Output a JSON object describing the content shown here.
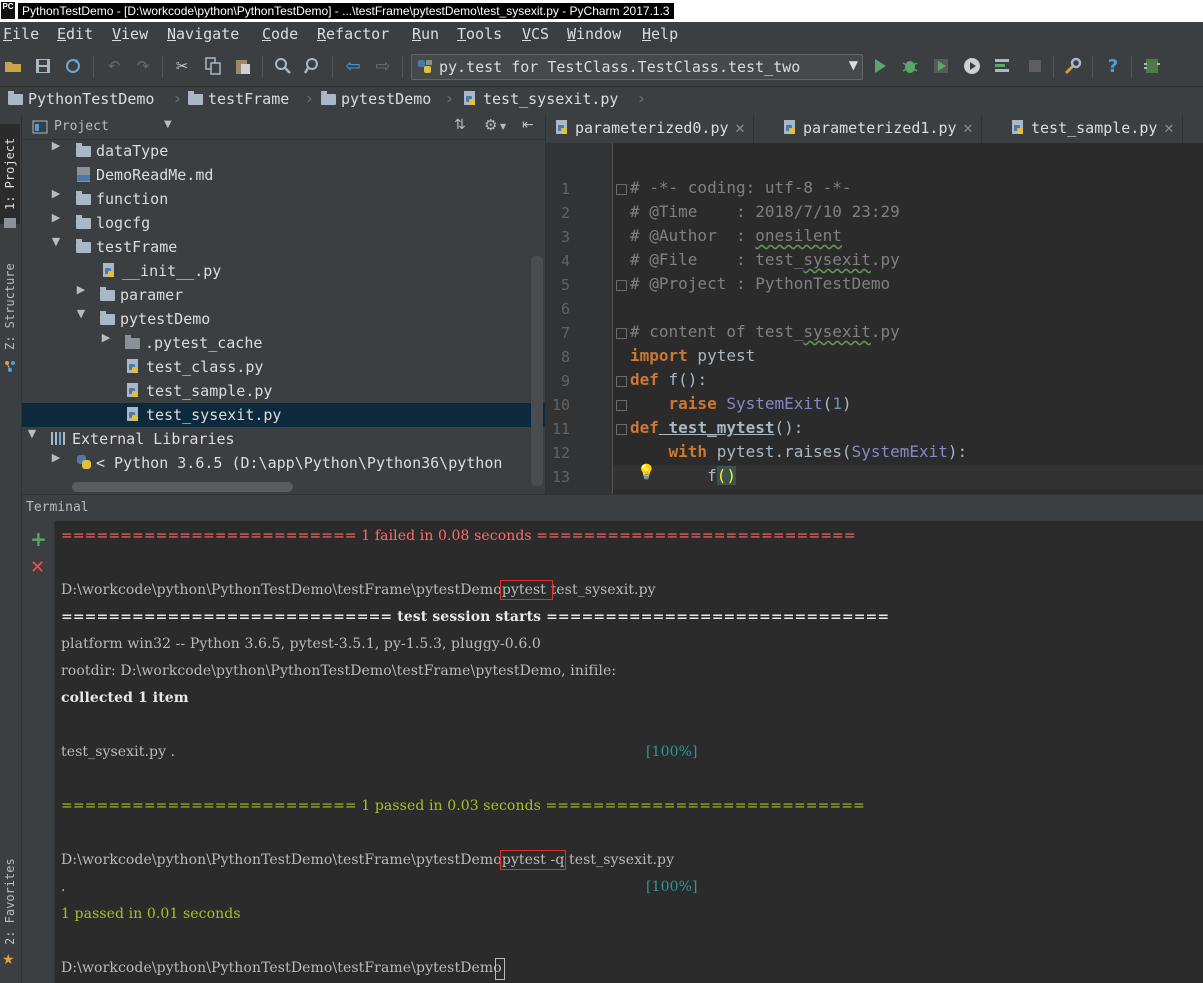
{
  "window": {
    "title": "PythonTestDemo - [D:\\workcode\\python\\PythonTestDemo] - ...\\testFrame\\pytestDemo\\test_sysexit.py - PyCharm 2017.1.3",
    "app_icon_text": "PC"
  },
  "menu": [
    "File",
    "Edit",
    "View",
    "Navigate",
    "Code",
    "Refactor",
    "Run",
    "Tools",
    "VCS",
    "Window",
    "Help"
  ],
  "toolbar": {
    "run_config": "py.test for TestClass.TestClass.test_two",
    "help_label": "?"
  },
  "breadcrumb": [
    "PythonTestDemo",
    "testFrame",
    "pytestDemo",
    "test_sysexit.py"
  ],
  "left_strip": {
    "project_tab": "1: Project",
    "structure_tab": "Z: Structure",
    "favorites_tab": "2: Favorites"
  },
  "project_panel": {
    "title": "Project",
    "tree": [
      {
        "label": "dataType",
        "kind": "folder",
        "expanded": false
      },
      {
        "label": "DemoReadMe.md",
        "kind": "md"
      },
      {
        "label": "function",
        "kind": "folder",
        "expanded": false
      },
      {
        "label": "logcfg",
        "kind": "folder",
        "expanded": false
      },
      {
        "label": "testFrame",
        "kind": "folder",
        "expanded": true
      },
      {
        "label": "__init__.py",
        "kind": "py"
      },
      {
        "label": "paramer",
        "kind": "folder",
        "expanded": false
      },
      {
        "label": "pytestDemo",
        "kind": "folder",
        "expanded": true
      },
      {
        "label": ".pytest_cache",
        "kind": "folder",
        "expanded": false
      },
      {
        "label": "test_class.py",
        "kind": "py"
      },
      {
        "label": "test_sample.py",
        "kind": "py"
      },
      {
        "label": "test_sysexit.py",
        "kind": "py",
        "selected": true
      },
      {
        "label": "External Libraries",
        "kind": "lib",
        "expanded": true
      },
      {
        "label": "< Python 3.6.5 (D:\\app\\Python\\Python36\\python",
        "kind": "pylib",
        "expanded": false
      }
    ]
  },
  "editor_tabs": [
    "parameterized0.py",
    "parameterized1.py",
    "test_sample.py"
  ],
  "editor": {
    "line_numbers": [
      "1",
      "2",
      "3",
      "4",
      "5",
      "6",
      "7",
      "8",
      "9",
      "10",
      "11",
      "12",
      "13"
    ],
    "comment1": "# -*- coding: utf-8 -*-",
    "time_label": "# @Time    : ",
    "time_value": "2018/7/10 23:29",
    "author_label": "# @Author  : ",
    "author_value": "onesilent",
    "file_label": "# @File    : test_",
    "file_sq": "sysexit",
    "file_ext": ".py",
    "project_line": "# @Project : PythonTestDemo",
    "content_pre": "# content of test_",
    "content_sq": "sysexit",
    "content_ext": ".py",
    "kw_import": "import",
    "import_mod": " pytest",
    "kw_def": "def",
    "f_name": " f",
    "f_rest": "():",
    "kw_raise": "raise",
    "sysexit": "SystemExit",
    "paren_open": "(",
    "num_one": "1",
    "paren_close": ")",
    "test_fn": " test_mytest",
    "kw_with": "with",
    "with_mid": " pytest.raises(",
    "with_end": "):",
    "call_f": "f",
    "call_parens": "()"
  },
  "terminal": {
    "title": "Terminal",
    "failed_line": "========================= 1 failed in 0.08 seconds ===========================",
    "prompt1": "D:\\workcode\\python\\PythonTestDemo\\testFrame\\pytestDemo",
    "cmd1": "pytest ",
    "cmd1_rest": "test_sysexit.py",
    "session_line": "============================ test session starts =============================",
    "platform_line": "platform win32 -- Python 3.6.5, pytest-3.5.1, py-1.5.3, pluggy-0.6.0",
    "rootdir_line": "rootdir: D:\\workcode\\python\\PythonTestDemo\\testFrame\\pytestDemo, inifile:",
    "collected_line": "collected 1 item",
    "result_file": "test_sysexit.py .",
    "progress1": "[100%]",
    "passed_line": "========================= 1 passed in 0.03 seconds ===========================",
    "prompt2": "D:\\workcode\\python\\PythonTestDemo\\testFrame\\pytestDemo",
    "cmd2": "pytest -q",
    "cmd2_rest": " test_sysexit.py",
    "dot": ".",
    "progress2": "[100%]",
    "passed_q": "1 passed in 0.01 seconds",
    "prompt3": "D:\\workcode\\python\\PythonTestDemo\\testFrame\\pytestDemo"
  }
}
